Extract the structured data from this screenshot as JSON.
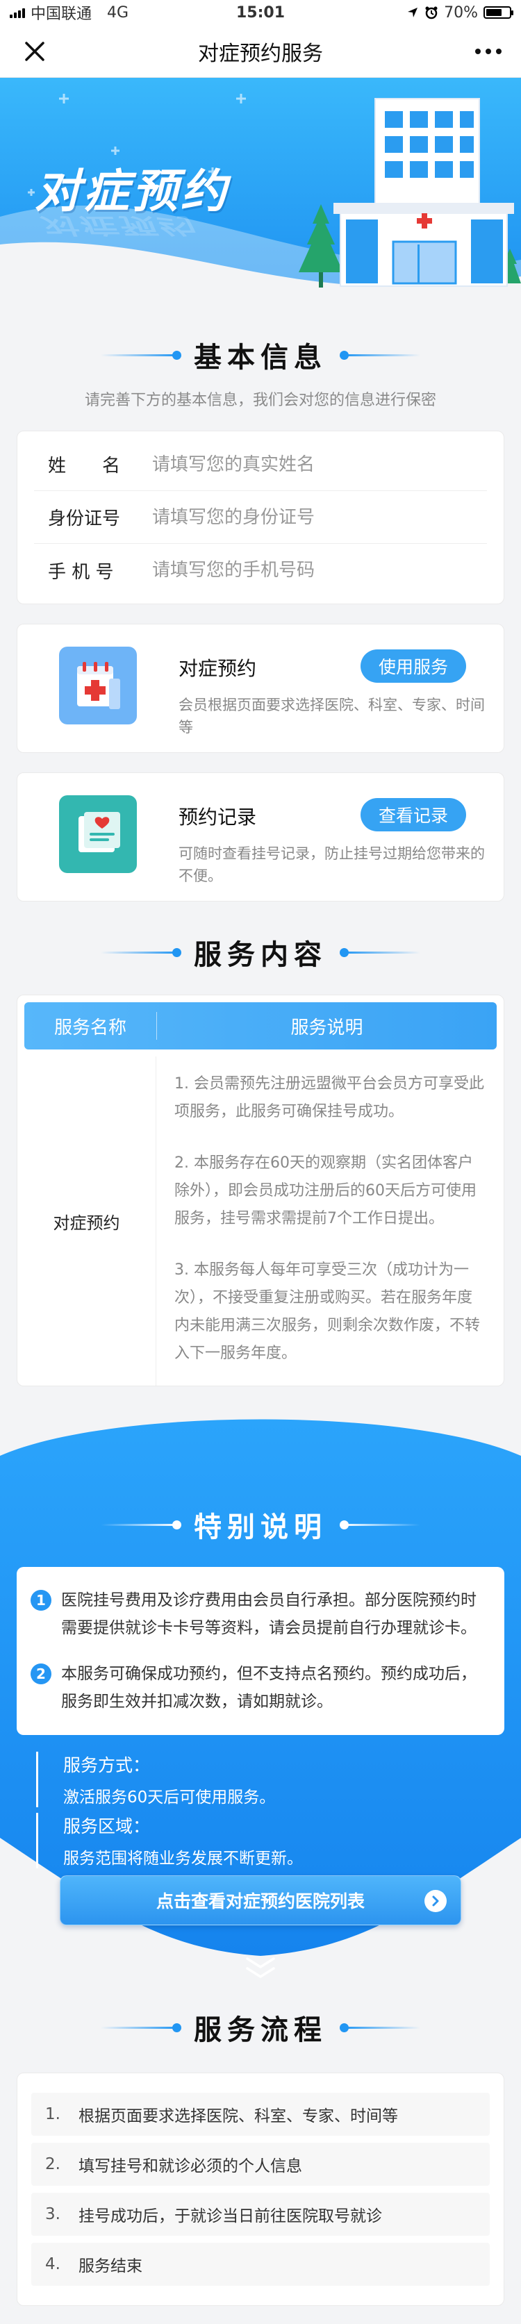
{
  "status_bar": {
    "carrier": "中国联通",
    "network": "4G",
    "time": "15:01",
    "battery": "70%",
    "battery_level": 0.7
  },
  "nav": {
    "title": "对症预约服务",
    "close_icon": "close-icon",
    "more_icon": "more-icon"
  },
  "hero": {
    "title": "对症预约"
  },
  "basic_info": {
    "title": "基本信息",
    "subtitle": "请完善下方的基本信息，我们会对您的信息进行保密",
    "fields": [
      {
        "label": "姓　　名",
        "placeholder": "请填写您的真实姓名"
      },
      {
        "label": "身份证号",
        "placeholder": "请填写您的身份证号"
      },
      {
        "label": "手 机 号",
        "placeholder": "请填写您的手机号码"
      }
    ]
  },
  "services": [
    {
      "name": "对症预约",
      "button": "使用服务",
      "desc": "会员根据页面要求选择医院、科室、专家、时间等"
    },
    {
      "name": "预约记录",
      "button": "查看记录",
      "desc": "可随时查看挂号记录，防止挂号过期给您带来的不便。"
    }
  ],
  "service_content": {
    "title": "服务内容",
    "headers": [
      "服务名称",
      "服务说明"
    ],
    "row_name": "对症预约",
    "descriptions": [
      "1. 会员需预先注册远盟微平台会员方可享受此项服务，此服务可确保挂号成功。",
      "2. 本服务存在60天的观察期（实名团体客户除外），即会员成功注册后的60天后方可使用服务，挂号需求需提前7个工作日提出。",
      "3. 本服务每人每年可享受三次（成功计为一次），不接受重复注册或购买。若在服务年度内未能用满三次服务，则剩余次数作废，不转入下一服务年度。"
    ]
  },
  "special": {
    "title": "特别说明",
    "notices": [
      {
        "num": "1",
        "text": "医院挂号费用及诊疗费用由会员自行承担。部分医院预约时需要提供就诊卡卡号等资料，请会员提前自行办理就诊卡。"
      },
      {
        "num": "2",
        "text": "本服务可确保成功预约，但不支持点名预约。预约成功后，服务即生效并扣减次数，请如期就诊。"
      }
    ],
    "method_title": "服务方式：",
    "method_text": "激活服务60天后可使用服务。",
    "area_title": "服务区域：",
    "area_text": "服务范围将随业务发展不断更新。",
    "hospital_button": "点击查看对症预约医院列表"
  },
  "flow": {
    "title": "服务流程",
    "steps": [
      {
        "num": "1.",
        "text": "根据页面要求选择医院、科室、专家、时间等"
      },
      {
        "num": "2.",
        "text": "填写挂号和就诊必须的个人信息"
      },
      {
        "num": "3.",
        "text": "挂号成功后，于就诊当日前往医院取号就诊"
      },
      {
        "num": "4.",
        "text": "服务结束"
      }
    ]
  },
  "colors": {
    "primary": "#2196f3",
    "button": "#36a3f3",
    "background": "#f3f4f6"
  }
}
